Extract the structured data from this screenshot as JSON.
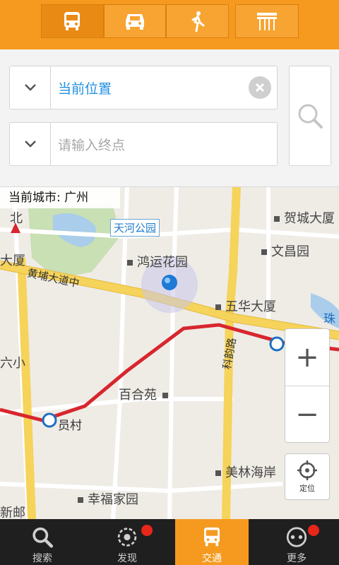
{
  "modes": [
    {
      "name": "bus",
      "icon": "bus-icon",
      "active": true
    },
    {
      "name": "car",
      "icon": "car-icon",
      "active": false
    },
    {
      "name": "walk",
      "icon": "walk-icon",
      "active": false
    },
    {
      "name": "station",
      "icon": "bus-stop-icon",
      "active": false
    }
  ],
  "route": {
    "start_value": "当前位置",
    "end_placeholder": "请输入终点"
  },
  "map": {
    "current_city": "当前城市: 广州",
    "park_label": "天河公园",
    "places": {
      "hongyun": "鸿运花园",
      "wuhua": "五华大厦",
      "hecheng": "贺城大厦",
      "wenchang": "文昌园",
      "baihe": "百合苑",
      "meilin": "美林海岸",
      "xingfu": "幸福家园",
      "xinyou": "新邮",
      "liuxiao": "六小",
      "dasha": "大厦",
      "bei": "北"
    },
    "roads": {
      "huangpu": "黄埔大道中",
      "keyun": "科韵路"
    },
    "stations": {
      "yuancun": "员村",
      "zhu": "珠"
    },
    "locate_label": "定位",
    "colors": {
      "metro_line": "#d8262e",
      "main_road": "#f6d35a",
      "water": "#a9cdea",
      "green": "#c9dfb4"
    }
  },
  "nav": [
    {
      "label": "搜索",
      "icon": "search-icon",
      "badge": false
    },
    {
      "label": "发现",
      "icon": "discover-icon",
      "badge": true
    },
    {
      "label": "交通",
      "icon": "bus-icon",
      "badge": false,
      "active": true
    },
    {
      "label": "更多",
      "icon": "more-icon",
      "badge": true
    }
  ]
}
